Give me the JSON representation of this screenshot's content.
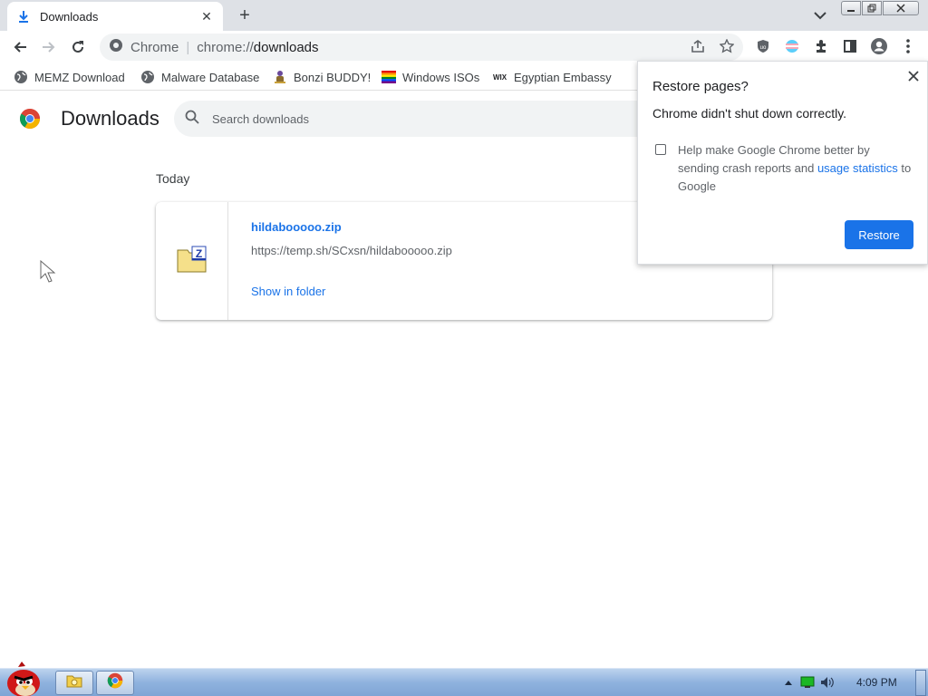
{
  "browser": {
    "tab": {
      "title": "Downloads",
      "close": "✕"
    },
    "new_tab": "+",
    "omnibox": {
      "site_label": "Chrome",
      "url_scheme": "chrome://",
      "url_path": "downloads"
    }
  },
  "bookmarks": [
    {
      "label": "MEMZ Download",
      "icon": "globe-icon"
    },
    {
      "label": "Malware Database",
      "icon": "globe-icon"
    },
    {
      "label": "Bonzi BUDDY!",
      "icon": "bonzi-icon"
    },
    {
      "label": "Windows ISOs",
      "icon": "rainbow-flag-icon"
    },
    {
      "label": "Egyptian Embassy",
      "icon": "wix-icon"
    }
  ],
  "downloads_page": {
    "title": "Downloads",
    "search_placeholder": "Search downloads",
    "section_label": "Today",
    "items": [
      {
        "file_name": "hildabooooo.zip",
        "url": "https://temp.sh/SCxsn/hildabooooo.zip",
        "action": "Show in folder",
        "icon": "zip-folder-icon"
      }
    ]
  },
  "restore_popup": {
    "title": "Restore pages?",
    "message": "Chrome didn't shut down correctly.",
    "checkbox_text_before": "Help make Google Chrome better by sending crash reports and ",
    "checkbox_link": "usage statistics",
    "checkbox_text_after": " to Google",
    "checkbox_checked": false,
    "button": "Restore"
  },
  "taskbar": {
    "clock": "4:09 PM"
  },
  "colors": {
    "accent": "#1a73e8",
    "tab_strip": "#dee1e6",
    "omnibox": "#f1f3f4"
  }
}
